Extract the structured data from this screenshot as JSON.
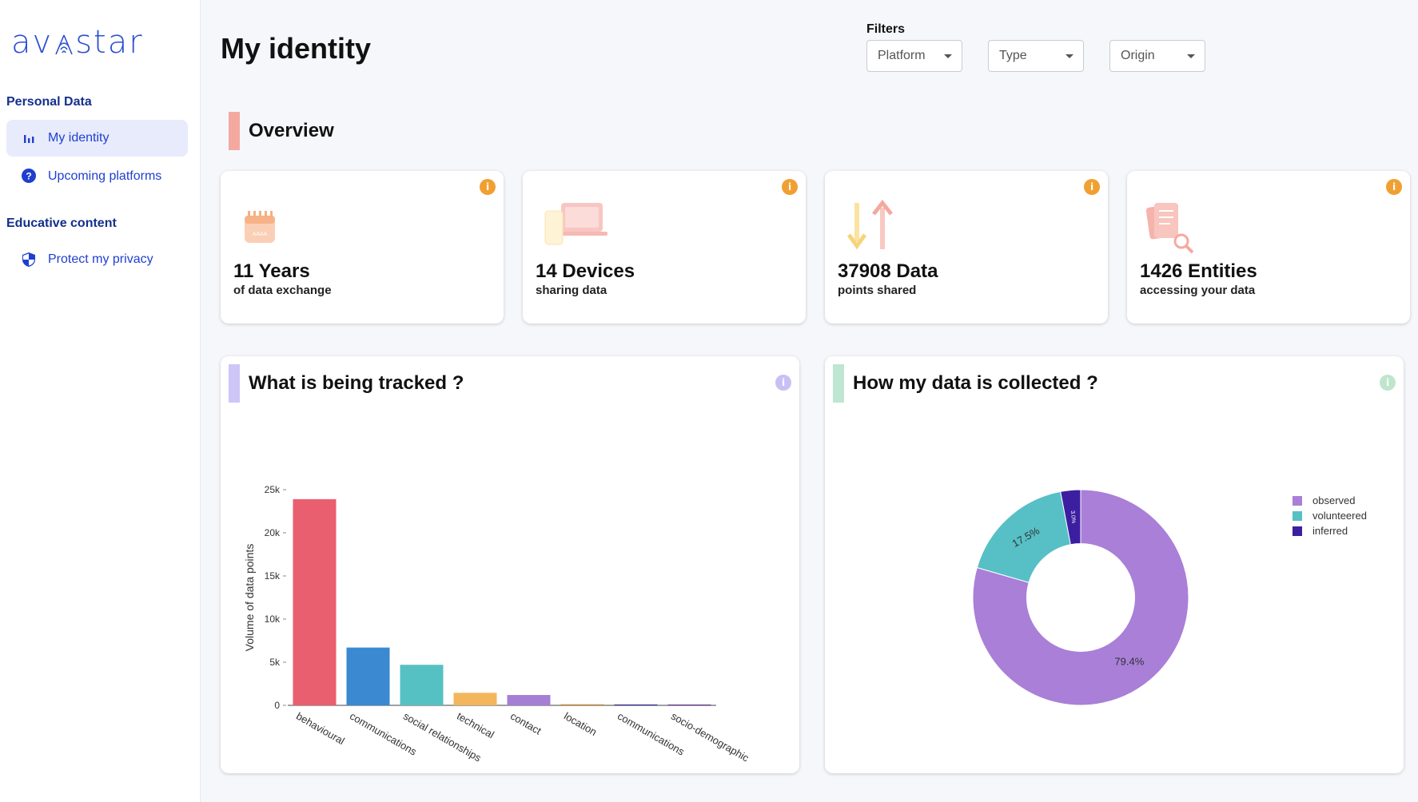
{
  "app": {
    "logo_text": "avastar",
    "page_title": "My identity"
  },
  "sidebar": {
    "sections": [
      {
        "title": "Personal Data",
        "items": [
          {
            "label": "My identity",
            "icon": "bar-chart-icon",
            "active": true
          },
          {
            "label": "Upcoming platforms",
            "icon": "help-circle-icon",
            "active": false
          }
        ]
      },
      {
        "title": "Educative content",
        "items": [
          {
            "label": "Protect my privacy",
            "icon": "shield-icon",
            "active": false
          }
        ]
      }
    ]
  },
  "filters": {
    "label": "Filters",
    "selects": [
      {
        "value": "Platform"
      },
      {
        "value": "Type"
      },
      {
        "value": "Origin"
      }
    ]
  },
  "overview": {
    "title": "Overview",
    "accent": "#f4a9a0",
    "cards": [
      {
        "big": "11 Years",
        "small": "of data exchange",
        "icon": "calendar-icon"
      },
      {
        "big": "14 Devices",
        "small": "sharing data",
        "icon": "devices-icon"
      },
      {
        "big": "37908 Data",
        "small": "points shared",
        "icon": "arrows-exchange-icon"
      },
      {
        "big": "1426 Entities",
        "small": "accessing your data",
        "icon": "document-search-icon"
      }
    ],
    "info_color": "#f0a032"
  },
  "tracked": {
    "title": "What is being tracked ?",
    "accent": "#cdc6f6",
    "info_color": "#c8c0f5"
  },
  "collected": {
    "title": "How my data is collected ?",
    "accent": "#bfe6d2",
    "info_color": "#bfe6cc"
  },
  "chart_data": [
    {
      "type": "bar",
      "title": "",
      "xlabel": "",
      "ylabel": "Volume of data points",
      "ylim": [
        0,
        25000
      ],
      "yticks": [
        "0",
        "5k",
        "10k",
        "15k",
        "20k",
        "25k"
      ],
      "categories": [
        "behavioural",
        "communications",
        "social relationships",
        "technical",
        "contact",
        "location",
        "communications",
        "socio-demographic"
      ],
      "values": [
        23900,
        6700,
        4700,
        1450,
        1200,
        120,
        100,
        90
      ],
      "colors": [
        "#ea5f6f",
        "#3b8ad1",
        "#55c1c3",
        "#f3b65c",
        "#a57fd3",
        "#c98d3e",
        "#2f2c8f",
        "#5a2d8a"
      ]
    },
    {
      "type": "pie",
      "hole": 0.5,
      "labels": [
        "observed",
        "volunteered",
        "inferred"
      ],
      "values": [
        79.4,
        17.5,
        3.0
      ],
      "value_labels": [
        "79.4%",
        "17.5%",
        "3.0%"
      ],
      "colors": [
        "#a97fd8",
        "#56c0c6",
        "#3c1fa0"
      ],
      "legend_position": "right"
    }
  ]
}
